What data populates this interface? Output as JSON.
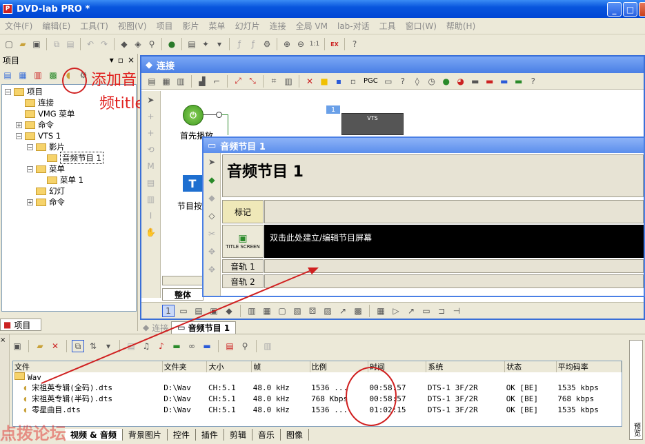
{
  "window": {
    "title": "DVD-lab PRO *"
  },
  "menu": [
    "文件(F)",
    "编辑(E)",
    "工具(T)",
    "视图(V)",
    "项目",
    "影片",
    "菜单",
    "幻灯片",
    "连接",
    "全局 VM",
    "lab-对话",
    "工具",
    "窗口(W)",
    "帮助(H)"
  ],
  "project_panel": {
    "title": "项目",
    "tree": [
      {
        "label": "项目",
        "level": 0,
        "toggle": "−"
      },
      {
        "label": "连接",
        "level": 1
      },
      {
        "label": "VMG 菜单",
        "level": 1
      },
      {
        "label": "命令",
        "level": 1,
        "toggle": "+"
      },
      {
        "label": "VTS 1",
        "level": 1,
        "toggle": "−"
      },
      {
        "label": "影片",
        "level": 2,
        "toggle": "−"
      },
      {
        "label": "音频节目 1",
        "level": 3,
        "selected": true
      },
      {
        "label": "菜单",
        "level": 2,
        "toggle": "−"
      },
      {
        "label": "菜单 1",
        "level": 3
      },
      {
        "label": "幻灯",
        "level": 2
      },
      {
        "label": "命令",
        "level": 2,
        "toggle": "+"
      }
    ],
    "tab": "项目"
  },
  "annotations": {
    "add_audio_line1": "添加音",
    "add_audio_line2": "频title",
    "watermark": "点拨论坛"
  },
  "connections_window": {
    "title": "连接",
    "first_play_label": "首先播放",
    "title_button_label": "节目按",
    "vts_badge": "1",
    "vts_label": "VTS",
    "pgc_label": "PGC",
    "overall_tab": "整体"
  },
  "audio_window": {
    "title": "音频节目 1",
    "heading": "音频节目 1",
    "marker_label": "标记",
    "title_screen_label": "TITLE SCREEN",
    "title_screen_text": "双击此处建立/编辑节目屏幕",
    "tracks": [
      "音轨 1",
      "音轨 2"
    ]
  },
  "document_tabs": [
    {
      "label": "连接",
      "active": false
    },
    {
      "label": "音频节目 1",
      "active": true
    }
  ],
  "assets": {
    "columns": [
      "文件",
      "文件夹",
      "大小",
      "帧",
      "比例",
      "时间",
      "系统",
      "状态",
      "平均码率"
    ],
    "folder": "Wav",
    "rows": [
      {
        "file": "宋祖英专辑(全码).dts",
        "folder": "D:\\Wav",
        "size": "CH:5.1",
        "frame": "48.0 kHz",
        "ratio": "1536 ...",
        "time": "00:58:57",
        "system": "DTS-1 3F/2R",
        "status": "OK [BE]",
        "bitrate": "1535 kbps"
      },
      {
        "file": "宋祖英专辑(半码).dts",
        "folder": "D:\\Wav",
        "size": "CH:5.1",
        "frame": "48.0 kHz",
        "ratio": "768 Kbps",
        "time": "00:58:57",
        "system": "DTS-1 3F/2R",
        "status": "OK [BE]",
        "bitrate": "768 kbps"
      },
      {
        "file": "零星曲目.dts",
        "folder": "D:\\Wav",
        "size": "CH:5.1",
        "frame": "48.0 kHz",
        "ratio": "1536 ...",
        "time": "01:02:15",
        "system": "DTS-1 3F/2R",
        "status": "OK [BE]",
        "bitrate": "1535 kbps"
      }
    ],
    "tabs": [
      "视频 & 音频",
      "背景图片",
      "控件",
      "插件",
      "剪辑",
      "音乐",
      "图像"
    ],
    "side_label": "预览"
  }
}
